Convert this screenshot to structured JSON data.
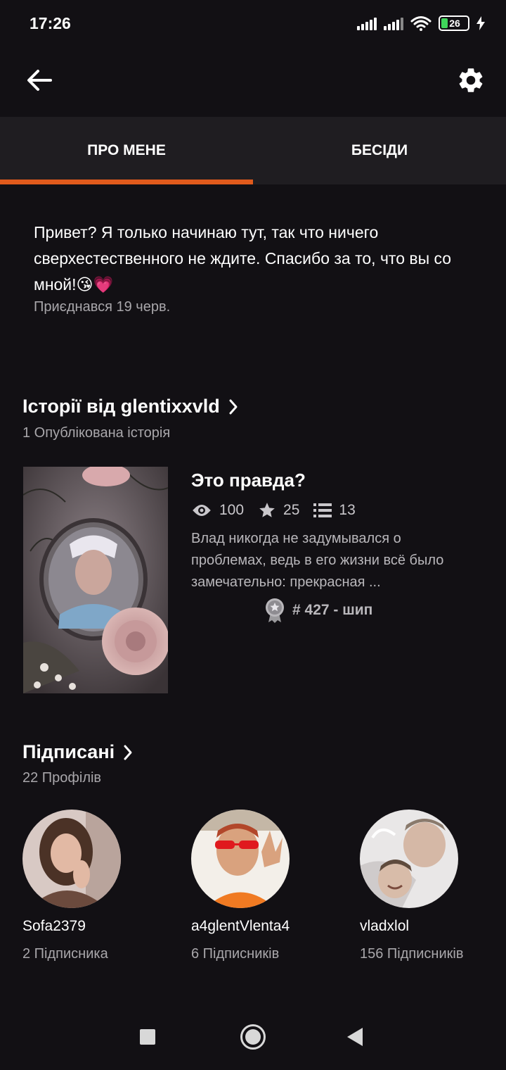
{
  "status_bar": {
    "time": "17:26",
    "battery": "26"
  },
  "tabs": [
    {
      "label": "ПРО МЕНЕ",
      "active": true
    },
    {
      "label": "БЕСІДИ",
      "active": false
    }
  ],
  "about": {
    "bio": "Привет? Я только начинаю тут, так что ничего сверхестественного не ждите. Спасибо за то, что вы со мной!😘💗",
    "joined": "Приєднався 19 черв."
  },
  "stories": {
    "title": "Історії від glentixxvld",
    "subtitle": "1 Опублікована історія",
    "items": [
      {
        "title": "Это правда?",
        "views": "100",
        "votes": "25",
        "parts": "13",
        "description": "Влад никогда не задумывался о проблемах, ведь в его жизни всё было замечательно: прекрасная ...",
        "rank": "# 427 - шип"
      }
    ]
  },
  "following": {
    "title": "Підписані",
    "subtitle": "22 Профілів",
    "profiles": [
      {
        "name": "Sofa2379",
        "followers": "2 Підписника"
      },
      {
        "name": "a4glentVlenta4",
        "followers": "6 Підписників"
      },
      {
        "name": "vladxlol",
        "followers": "156 Підписників"
      }
    ]
  },
  "colors": {
    "background": "#121014",
    "tab_bar": "#1f1d21",
    "accent": "#e05a1c"
  }
}
